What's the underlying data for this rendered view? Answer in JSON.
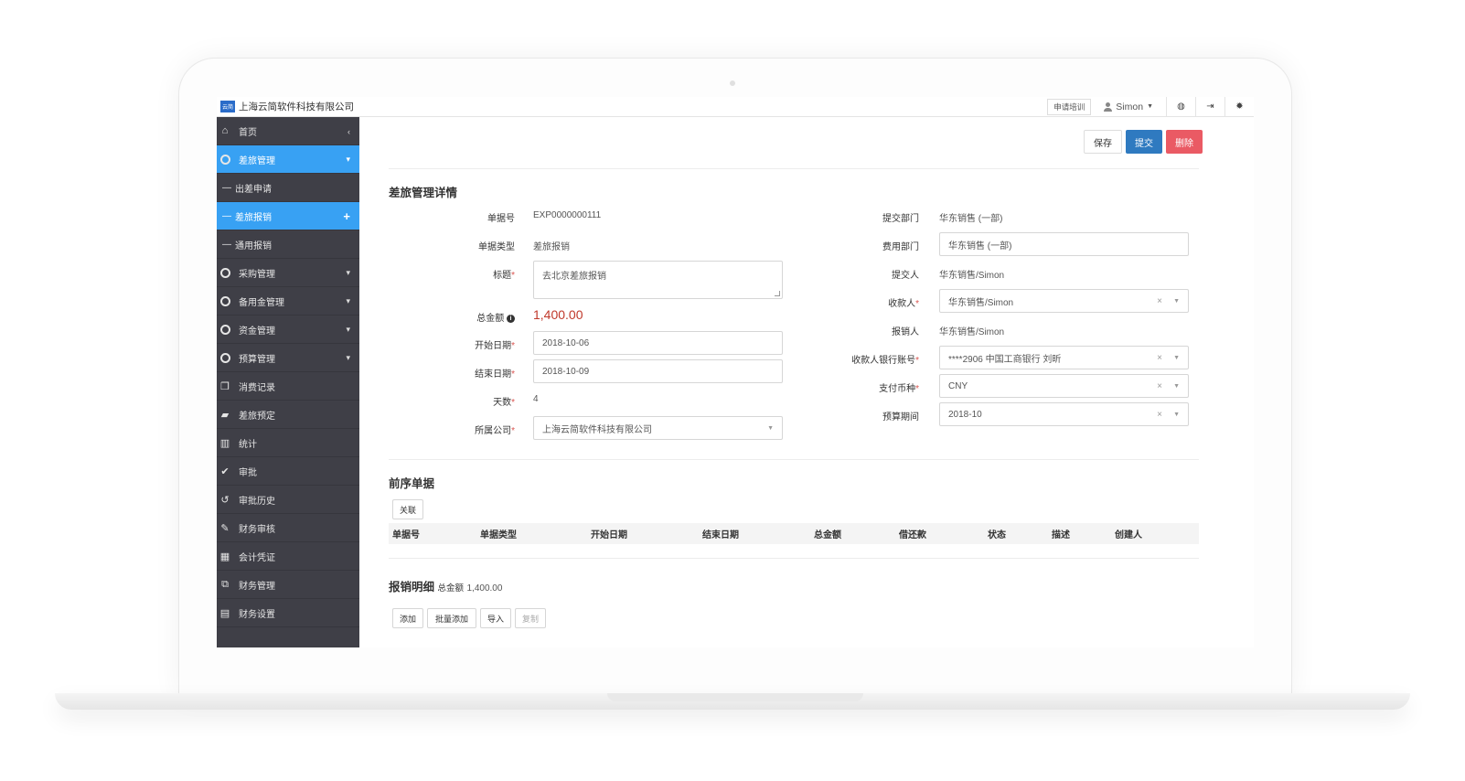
{
  "topbar": {
    "logo_text": "云简",
    "company": "上海云简软件科技有限公司",
    "training": "申请培训",
    "user": "Simon"
  },
  "sidebar": {
    "items": [
      {
        "label": "首页",
        "right": "‹"
      },
      {
        "label": "差旅管理",
        "right": "▾"
      },
      {
        "label": "出差申请"
      },
      {
        "label": "差旅报销",
        "right": "+"
      },
      {
        "label": "通用报销"
      },
      {
        "label": "采购管理",
        "right": "▾"
      },
      {
        "label": "备用金管理",
        "right": "▾"
      },
      {
        "label": "资金管理",
        "right": "▾"
      },
      {
        "label": "预算管理",
        "right": "▾"
      },
      {
        "label": "消费记录"
      },
      {
        "label": "差旅预定"
      },
      {
        "label": "统计"
      },
      {
        "label": "审批"
      },
      {
        "label": "审批历史"
      },
      {
        "label": "财务审核"
      },
      {
        "label": "会计凭证"
      },
      {
        "label": "财务管理"
      },
      {
        "label": "财务设置"
      }
    ]
  },
  "actions": {
    "save": "保存",
    "submit": "提交",
    "delete": "删除"
  },
  "detail": {
    "title": "差旅管理详情",
    "doc_no_label": "单据号",
    "doc_no": "EXP0000000111",
    "doc_type_label": "单据类型",
    "doc_type": "差旅报销",
    "subject_label": "标题",
    "subject": "去北京差旅报销",
    "total_label": "总金额",
    "total": "1,400.00",
    "start_label": "开始日期",
    "start": "2018-10-06",
    "end_label": "结束日期",
    "end": "2018-10-09",
    "days_label": "天数",
    "days": "4",
    "company_label": "所属公司",
    "company": "上海云简软件科技有限公司",
    "submit_dept_label": "提交部门",
    "submit_dept": "华东销售 (一部)",
    "cost_dept_label": "费用部门",
    "cost_dept": "华东销售 (一部)",
    "submitter_label": "提交人",
    "submitter": "华东销售/Simon",
    "payee_label": "收款人",
    "payee": "华东销售/Simon",
    "reimburser_label": "报销人",
    "reimburser": "华东销售/Simon",
    "bank_label": "收款人银行账号",
    "bank": "****2906 中国工商银行 刘昕",
    "currency_label": "支付币种",
    "currency": "CNY",
    "budget_label": "预算期间",
    "budget": "2018-10",
    "required_mark": "*"
  },
  "prior": {
    "title": "前序单据",
    "link_btn": "关联",
    "columns": [
      "单据号",
      "单据类型",
      "开始日期",
      "结束日期",
      "总金额",
      "借还款",
      "状态",
      "描述",
      "创建人"
    ]
  },
  "lines": {
    "title": "报销明细",
    "total_label": "总金额",
    "total": "1,400.00",
    "buttons": [
      "添加",
      "批量添加",
      "导入",
      "复制"
    ]
  }
}
